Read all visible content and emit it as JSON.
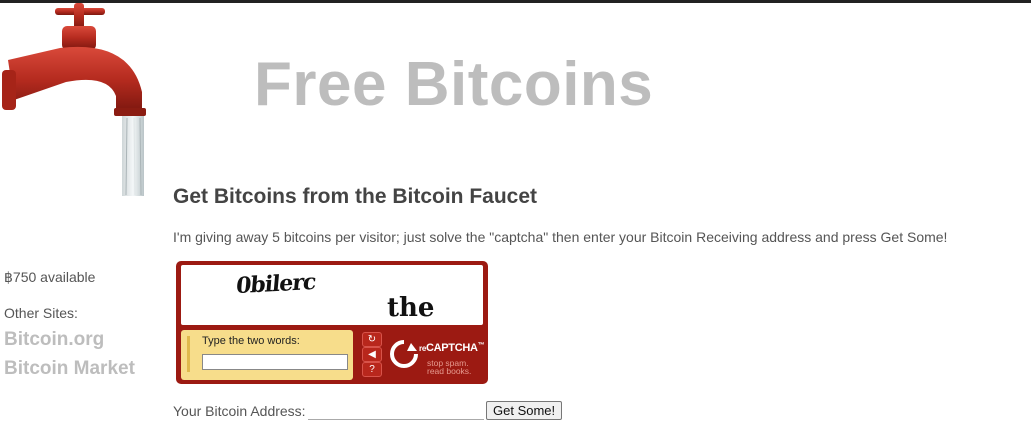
{
  "header": {
    "title": "Free Bitcoins"
  },
  "main": {
    "heading": "Get Bitcoins from the Bitcoin Faucet",
    "intro": "I'm giving away 5 bitcoins per visitor; just solve the \"captcha\" then enter your Bitcoin Receiving address and press Get Some!"
  },
  "sidebar": {
    "available": "฿750 available",
    "other_sites_label": "Other Sites:",
    "links": [
      {
        "label": "Bitcoin.org"
      },
      {
        "label": "Bitcoin Market"
      }
    ]
  },
  "captcha": {
    "word_1": "0bilerc",
    "word_2": "the",
    "prompt": "Type the two words:",
    "input_value": "",
    "controls": [
      {
        "icon": "refresh-icon",
        "glyph": "↻"
      },
      {
        "icon": "audio-icon",
        "glyph": "◀"
      },
      {
        "icon": "help-icon",
        "glyph": "?"
      }
    ],
    "brand_prefix": "re",
    "brand_name": "CAPTCHA",
    "brand_tm": "™",
    "brand_tagline": "stop spam. read books."
  },
  "form": {
    "address_label": "Your Bitcoin Address:",
    "address_value": "",
    "submit_label": "Get Some!"
  },
  "colors": {
    "title_gray": "#bdbdbd",
    "captcha_red": "#9c1a12",
    "captcha_input_bg": "#f7dd8b"
  }
}
